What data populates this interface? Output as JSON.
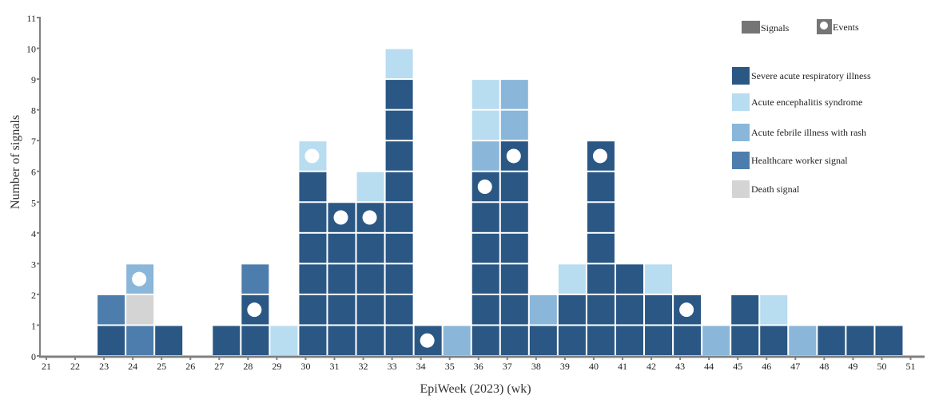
{
  "chart_data": {
    "type": "bar",
    "stacked": true,
    "xlabel": "EpiWeek (2023) (wk)",
    "ylabel": "Number of signals",
    "x_ticks": [
      21,
      22,
      23,
      24,
      25,
      26,
      27,
      28,
      29,
      30,
      31,
      32,
      33,
      34,
      35,
      36,
      37,
      38,
      39,
      40,
      41,
      42,
      43,
      44,
      45,
      46,
      47,
      48,
      49,
      50,
      51
    ],
    "y_ticks": [
      0,
      1,
      2,
      3,
      4,
      5,
      6,
      7,
      8,
      9,
      10,
      11
    ],
    "ylim": [
      0,
      11
    ],
    "xlim": [
      21,
      51
    ],
    "grid": false,
    "legend_position": "top-right",
    "legend_markers": [
      {
        "key": "signals",
        "label": "Signals",
        "color": "#757575"
      },
      {
        "key": "events",
        "label": "Events",
        "color": "#757575"
      }
    ],
    "categories_legend": [
      {
        "key": "sari",
        "label": "Severe acute respiratory illness",
        "color": "#2b5784"
      },
      {
        "key": "aes",
        "label": "Acute encephalitis syndrome",
        "color": "#b8dcf0"
      },
      {
        "key": "afir",
        "label": "Acute febrile illness with rash",
        "color": "#8ab6d9"
      },
      {
        "key": "hcw",
        "label": "Healthcare worker signal",
        "color": "#4d7dac"
      },
      {
        "key": "death",
        "label": "Death signal",
        "color": "#d4d4d4"
      }
    ],
    "weeks": [
      {
        "week": 23,
        "stack": [
          "sari",
          "hcw"
        ],
        "events": []
      },
      {
        "week": 24,
        "stack": [
          "hcw",
          "death",
          "afir"
        ],
        "events": [
          3
        ]
      },
      {
        "week": 25,
        "stack": [
          "sari"
        ],
        "events": []
      },
      {
        "week": 27,
        "stack": [
          "sari"
        ],
        "events": []
      },
      {
        "week": 28,
        "stack": [
          "sari",
          "sari",
          "hcw"
        ],
        "events": [
          2
        ]
      },
      {
        "week": 29,
        "stack": [
          "aes"
        ],
        "events": []
      },
      {
        "week": 30,
        "stack": [
          "sari",
          "sari",
          "sari",
          "sari",
          "sari",
          "sari",
          "aes"
        ],
        "events": [
          7
        ]
      },
      {
        "week": 31,
        "stack": [
          "sari",
          "sari",
          "sari",
          "sari",
          "sari"
        ],
        "events": [
          5
        ]
      },
      {
        "week": 32,
        "stack": [
          "sari",
          "sari",
          "sari",
          "sari",
          "sari",
          "aes"
        ],
        "events": [
          5
        ]
      },
      {
        "week": 33,
        "stack": [
          "sari",
          "sari",
          "sari",
          "sari",
          "sari",
          "sari",
          "sari",
          "sari",
          "sari",
          "aes"
        ],
        "events": []
      },
      {
        "week": 34,
        "stack": [
          "sari"
        ],
        "events": [
          1
        ]
      },
      {
        "week": 35,
        "stack": [
          "afir"
        ],
        "events": []
      },
      {
        "week": 36,
        "stack": [
          "sari",
          "sari",
          "sari",
          "sari",
          "sari",
          "sari",
          "afir",
          "aes",
          "aes"
        ],
        "events": [
          6
        ]
      },
      {
        "week": 37,
        "stack": [
          "sari",
          "sari",
          "sari",
          "sari",
          "sari",
          "sari",
          "sari",
          "afir",
          "afir"
        ],
        "events": [
          7
        ]
      },
      {
        "week": 38,
        "stack": [
          "sari",
          "afir"
        ],
        "events": []
      },
      {
        "week": 39,
        "stack": [
          "sari",
          "sari",
          "aes"
        ],
        "events": []
      },
      {
        "week": 40,
        "stack": [
          "sari",
          "sari",
          "sari",
          "sari",
          "sari",
          "sari",
          "sari"
        ],
        "events": [
          7
        ]
      },
      {
        "week": 41,
        "stack": [
          "sari",
          "sari",
          "sari"
        ],
        "events": []
      },
      {
        "week": 42,
        "stack": [
          "sari",
          "sari",
          "aes"
        ],
        "events": []
      },
      {
        "week": 43,
        "stack": [
          "sari",
          "sari"
        ],
        "events": [
          2
        ]
      },
      {
        "week": 44,
        "stack": [
          "afir"
        ],
        "events": []
      },
      {
        "week": 45,
        "stack": [
          "sari",
          "sari"
        ],
        "events": []
      },
      {
        "week": 46,
        "stack": [
          "sari",
          "aes"
        ],
        "events": []
      },
      {
        "week": 47,
        "stack": [
          "afir"
        ],
        "events": []
      },
      {
        "week": 48,
        "stack": [
          "sari"
        ],
        "events": []
      },
      {
        "week": 49,
        "stack": [
          "sari"
        ],
        "events": []
      },
      {
        "week": 50,
        "stack": [
          "sari"
        ],
        "events": []
      }
    ],
    "series_totals": {
      "sari": [
        1,
        0,
        1,
        1,
        2,
        0,
        6,
        5,
        5,
        9,
        1,
        0,
        6,
        7,
        1,
        2,
        7,
        3,
        2,
        2,
        0,
        2,
        1,
        0,
        1,
        1,
        1
      ],
      "aes": [
        0,
        0,
        0,
        0,
        0,
        1,
        1,
        0,
        1,
        1,
        0,
        0,
        2,
        0,
        0,
        1,
        0,
        0,
        1,
        0,
        0,
        0,
        1,
        0,
        0,
        0,
        0
      ],
      "afir": [
        0,
        1,
        0,
        0,
        0,
        0,
        0,
        0,
        0,
        0,
        0,
        1,
        1,
        2,
        1,
        0,
        0,
        0,
        0,
        0,
        1,
        0,
        0,
        1,
        0,
        0,
        0
      ],
      "hcw": [
        1,
        1,
        0,
        0,
        1,
        0,
        0,
        0,
        0,
        0,
        0,
        0,
        0,
        0,
        0,
        0,
        0,
        0,
        0,
        0,
        0,
        0,
        0,
        0,
        0,
        0,
        0
      ],
      "death": [
        0,
        1,
        0,
        0,
        0,
        0,
        0,
        0,
        0,
        0,
        0,
        0,
        0,
        0,
        0,
        0,
        0,
        0,
        0,
        0,
        0,
        0,
        0,
        0,
        0,
        0,
        0
      ]
    }
  }
}
